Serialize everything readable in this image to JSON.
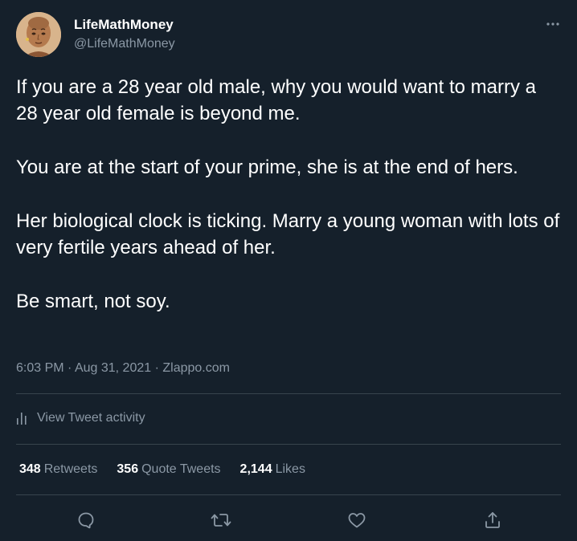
{
  "author": {
    "name": "LifeMathMoney",
    "handle": "@LifeMathMoney",
    "avatar_icon": "avatar-portrait"
  },
  "tweet": {
    "paragraphs": [
      "If you are a 28 year old male, why you would want to marry a 28 year old female is beyond me.",
      "You are at the start of your prime, she is at the end of hers.",
      "Her biological clock is ticking. Marry a young woman with lots of very fertile years ahead of her.",
      "Be smart, not soy."
    ],
    "time": "6:03 PM",
    "date": "Aug 31, 2021",
    "source": "Zlappo.com"
  },
  "activity": {
    "label": "View Tweet activity"
  },
  "stats": {
    "retweets": {
      "count": "348",
      "label": "Retweets"
    },
    "quotes": {
      "count": "356",
      "label": "Quote Tweets"
    },
    "likes": {
      "count": "2,144",
      "label": "Likes"
    }
  },
  "actions": {
    "icons": [
      "reply-icon",
      "retweet-icon",
      "like-icon",
      "share-icon"
    ]
  },
  "colors": {
    "background": "#15202b",
    "text": "#ffffff",
    "secondary": "#8b98a5",
    "divider": "#38444d"
  }
}
